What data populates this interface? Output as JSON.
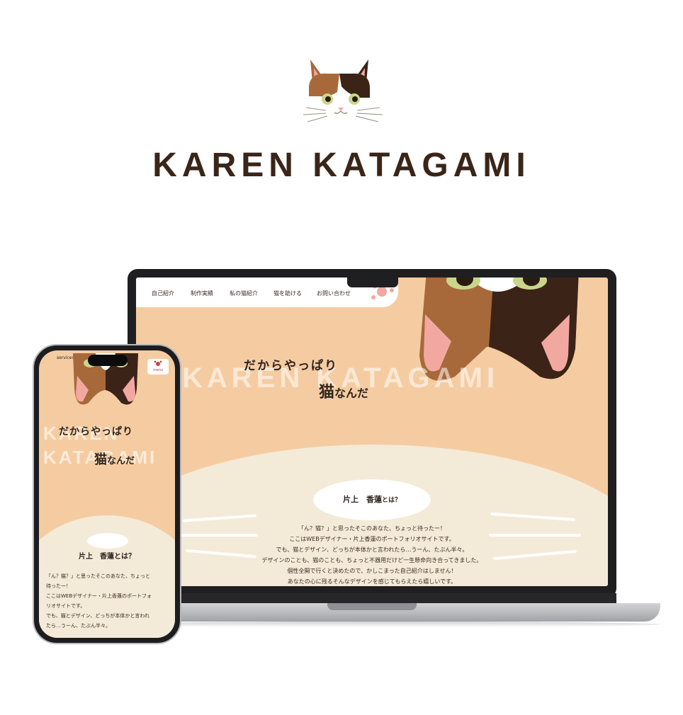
{
  "brand": {
    "title": "KAREN KATAGAMI"
  },
  "desktop": {
    "nav": [
      "自己紹介",
      "制作実績",
      "私の猫紹介",
      "猫を助ける",
      "お問い合わせ"
    ],
    "ghost": "KAREN KATAGAMI",
    "hero_line1": "だからやっぱり",
    "hero_big": "猫",
    "hero_rest": "なんだ",
    "about_name": "片上　香蓮",
    "about_suffix": "とは？",
    "intro_lines": [
      "「ん？猫？」と思ったそこのあなた、ちょっと待ったー！",
      "ここはWEBデザイナー・片上香蓮のポートフォリオサイトです。",
      "でも、猫とデザイン、どっちが本体かと言われたら…うーん、たぶん半々。",
      "デザインのことも、猫のことも、ちょっと不器用だけど一生懸命向き合ってきました。",
      "個性全開で行くと決めたので、かしこまった自己紹介はしません！",
      "あなたの心に残るそんなデザインを感じてもらえたら嬉しいです。"
    ]
  },
  "mobile": {
    "status_text": "services",
    "menu_label": "menu",
    "ghost_line1": "KAREN",
    "ghost_line2": "KATAGAMI",
    "hero_line1": "だからやっぱり",
    "hero_big": "猫",
    "hero_rest": "なんだ",
    "about_title": "片上　香蓮とは？",
    "intro_lines": [
      "「ん？猫？」と思ったそこのあなた、ちょっと",
      "待ったー！",
      "ここはWEBデザイナー・片上香蓮のポートフォ",
      "リオサイトです。",
      "でも、猫とデザイン、どっちが本体かと言われ",
      "たら…うーん、たぶん半々。"
    ]
  },
  "colors": {
    "peach": "#f5cca1",
    "cream": "#f4ead8",
    "text": "#3b2a22",
    "cat_brown": "#a8693a",
    "cat_dark": "#3b2318",
    "cat_pink": "#f2a8a0"
  }
}
